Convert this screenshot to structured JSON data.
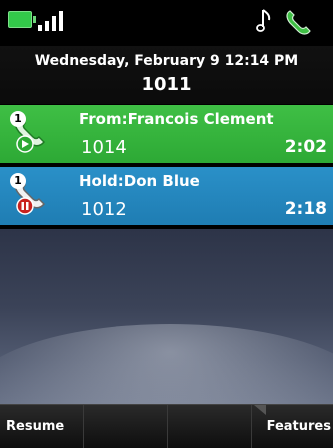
{
  "status_bar": {
    "battery_icon": "battery-icon",
    "signal_icon": "signal-strength-icon",
    "ringer_icon": "music-note-icon",
    "handset_icon": "handset-icon",
    "battery_color": "#33c94a"
  },
  "header": {
    "date_time": "Wednesday, February 9 12:14 PM",
    "line": "1011"
  },
  "calls": [
    {
      "title": "From:Francois Clement",
      "number": "1014",
      "duration": "2:02",
      "count": "1",
      "state": "active",
      "icon": "active-call-icon",
      "color": "#3fbf45"
    },
    {
      "title": "Hold:Don Blue",
      "number": "1012",
      "duration": "2:18",
      "count": "1",
      "state": "hold",
      "icon": "held-call-icon",
      "color": "#2a90c8"
    }
  ],
  "softkeys": {
    "key1": "Resume",
    "key2": "",
    "key3": "",
    "key4": "Features"
  }
}
